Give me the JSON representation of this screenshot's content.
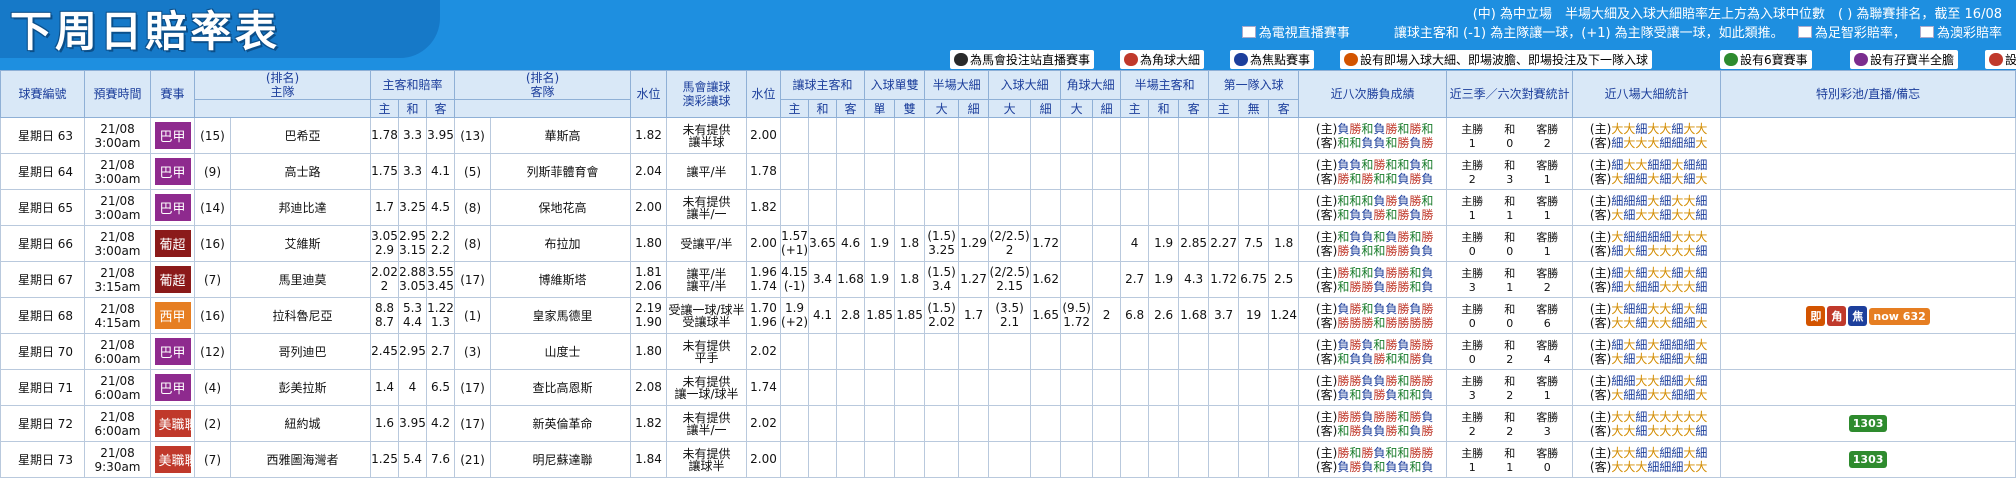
{
  "header": {
    "title": "下周日賠率表",
    "note1": "(中) 為中立場　半場大細及入球大細賠率左上方為入球中位數　( ) 為聯賽排名，截至 16/08",
    "note2_a": "為電視直播賽事",
    "note2_b": "讓球主客和 (-1) 為主隊讓一球，(+1) 為主隊受讓一球，如此類推。",
    "note2_c": "為足智彩賠率，",
    "note2_d": "為澳彩賠率"
  },
  "legend": [
    {
      "label": "為馬會投注站直播賽事",
      "icon": "tv-station-icon",
      "color": "#2a2a2a"
    },
    {
      "label": "為角球大細",
      "icon": "corner-icon",
      "color": "#c0392b"
    },
    {
      "label": "為焦點賽事",
      "icon": "focus-icon",
      "color": "#1d3f9c"
    },
    {
      "label": "設有即場入球大細、即場波膽、即場投注及下一隊入球",
      "icon": "live-icon",
      "color": "#d35400"
    },
    {
      "label": "設有6寶賽事",
      "icon": "six-icon",
      "color": "#2e8b2e"
    },
    {
      "label": "設有孖寶半全膽",
      "icon": "double-icon",
      "color": "#7b2d8e"
    },
    {
      "label": "設有首名入球賽事",
      "icon": "first-scorer-icon",
      "color": "#c0392b"
    }
  ],
  "columns": {
    "match_no": "球賽編號",
    "kickoff": "預賽時間",
    "league": "賽事",
    "home_rank": "(排名)",
    "home": "主隊",
    "hda": "主客和賠率",
    "h": "主",
    "d": "和",
    "a": "客",
    "away_rank": "(排名)",
    "away": "客隊",
    "line": "水位",
    "handicap": "馬會讓球",
    "handicap2": "澳彩讓球",
    "line2": "水位",
    "hhad": "讓球主客和",
    "ooe": "入球單雙",
    "odd": "單",
    "even": "雙",
    "fhl": "半場大細",
    "hil": "入球大細",
    "chl": "角球大細",
    "hi": "大",
    "lo": "細",
    "fha": "半場主客和",
    "fts": "第一隊入球",
    "none": "無",
    "last8": "近八次勝負成績",
    "h2h": "近三季／六次對賽統計",
    "last8hl": "近八場大細統計",
    "notes": "特別彩池/直播/備忘"
  },
  "rows": [
    {
      "no": "星期日 63",
      "date": "21/08",
      "time": "3:00am",
      "league": "巴甲",
      "lcolor": "#8e2a8e",
      "hr": "(15)",
      "home": "巴希亞",
      "h": "1.78",
      "d": "3.3",
      "a": "3.95",
      "ar": "(13)",
      "away": "華斯高",
      "w1": "1.82",
      "hc1": "未有提供",
      "hc2": "讓半球",
      "w2": "2.00",
      "hh": [
        "",
        "",
        ""
      ],
      "oe": [
        "",
        ""
      ],
      "fh": [
        "",
        ""
      ],
      "hl": [
        "",
        ""
      ],
      "ch": [
        "",
        ""
      ],
      "fa": [
        "",
        "",
        ""
      ],
      "ft": [
        "",
        "",
        ""
      ],
      "rec_h": "(主)負勝和負勝和勝和",
      "rec_a": "(客)和和負負和勝負勝",
      "h2h": [
        "主勝",
        "和",
        "客勝",
        "1",
        "0",
        "2"
      ],
      "hl_h": "(主)大大細大大細大大",
      "hl_a": "(客)細大大大細細細大",
      "notes": []
    },
    {
      "no": "星期日 64",
      "date": "21/08",
      "time": "3:00am",
      "league": "巴甲",
      "lcolor": "#8e2a8e",
      "hr": "(9)",
      "home": "高士路",
      "h": "1.75",
      "d": "3.3",
      "a": "4.1",
      "ar": "(5)",
      "away": "列斯菲體育會",
      "w1": "2.04",
      "hc1": "讓平/半",
      "hc2": "",
      "w2": "1.78",
      "hh": [
        "",
        "",
        ""
      ],
      "oe": [
        "",
        ""
      ],
      "fh": [
        "",
        ""
      ],
      "hl": [
        "",
        ""
      ],
      "ch": [
        "",
        ""
      ],
      "fa": [
        "",
        "",
        ""
      ],
      "ft": [
        "",
        "",
        ""
      ],
      "rec_h": "(主)負負和勝和和負和",
      "rec_a": "(客)勝和勝和和負勝負",
      "h2h": [
        "主勝",
        "和",
        "客勝",
        "2",
        "3",
        "1"
      ],
      "hl_h": "(主)細大大細細大細細",
      "hl_a": "(客)大細細大細大細大",
      "notes": []
    },
    {
      "no": "星期日 65",
      "date": "21/08",
      "time": "3:00am",
      "league": "巴甲",
      "lcolor": "#8e2a8e",
      "hr": "(14)",
      "home": "邦迪比達",
      "h": "1.7",
      "d": "3.25",
      "a": "4.5",
      "ar": "(8)",
      "away": "保地花高",
      "w1": "2.00",
      "hc1": "未有提供",
      "hc2": "讓半/一",
      "w2": "1.82",
      "hh": [
        "",
        "",
        ""
      ],
      "oe": [
        "",
        ""
      ],
      "fh": [
        "",
        ""
      ],
      "hl": [
        "",
        ""
      ],
      "ch": [
        "",
        ""
      ],
      "fa": [
        "",
        "",
        ""
      ],
      "ft": [
        "",
        "",
        ""
      ],
      "rec_h": "(主)和和和負勝負勝和",
      "rec_a": "(客)和負負勝和勝負勝",
      "h2h": [
        "主勝",
        "和",
        "客勝",
        "1",
        "1",
        "1"
      ],
      "hl_h": "(主)細細細大細大大細",
      "hl_a": "(客)大細大大細大大細",
      "notes": []
    },
    {
      "no": "星期日 66",
      "date": "21/08",
      "time": "3:00am",
      "league": "葡超",
      "lcolor": "#8b1a1a",
      "hr": "(16)",
      "home": "艾維斯",
      "h": "3.05",
      "d": "2.95",
      "a": "2.2",
      "h2": "2.9",
      "d2": "3.15",
      "a2": "2.2",
      "ar": "(8)",
      "away": "布拉加",
      "w1": "1.80",
      "hc1": "受讓平/半",
      "hc2": "",
      "w2": "2.00",
      "hh": [
        "1.57",
        "3.65",
        "4.6"
      ],
      "hhl": "(+1)",
      "oe": [
        "1.9",
        "1.8"
      ],
      "fh": [
        "(1.5)",
        ""
      ],
      "fhv": [
        "3.25",
        "1.29"
      ],
      "hl": [
        "(2/2.5)",
        ""
      ],
      "hlv": [
        "2",
        "1.72"
      ],
      "ch": [
        "",
        ""
      ],
      "fa": [
        "4",
        "1.9",
        "2.85"
      ],
      "ft": [
        "2.27",
        "7.5",
        "1.8"
      ],
      "rec_h": "(主)和負負和負勝和勝",
      "rec_a": "(客)勝負和和勝勝負負",
      "h2h": [
        "主勝",
        "和",
        "客勝",
        "0",
        "0",
        "1"
      ],
      "hl_h": "(主)大細細細細大大大",
      "hl_a": "(客)細大細大大大大細",
      "notes": []
    },
    {
      "no": "星期日 67",
      "date": "21/08",
      "time": "3:15am",
      "league": "葡超",
      "lcolor": "#8b1a1a",
      "hr": "(7)",
      "home": "馬里迪莫",
      "h": "2.02",
      "d": "2.88",
      "a": "3.55",
      "h2": "2",
      "d2": "3.05",
      "a2": "3.45",
      "ar": "(17)",
      "away": "博維斯塔",
      "w1": "1.81",
      "w1b": "2.06",
      "hc1": "讓平/半",
      "hc2": "讓平/半",
      "w2": "1.96",
      "w2b": "1.74",
      "hh": [
        "4.15",
        "3.4",
        "1.68"
      ],
      "hhl": "(-1)",
      "oe": [
        "1.9",
        "1.8"
      ],
      "fh": [
        "(1.5)",
        ""
      ],
      "fhv": [
        "3.4",
        "1.27"
      ],
      "hl": [
        "(2/2.5)",
        ""
      ],
      "hlv": [
        "2.15",
        "1.62"
      ],
      "ch": [
        "",
        ""
      ],
      "fa": [
        "2.7",
        "1.9",
        "4.3"
      ],
      "ft": [
        "1.72",
        "6.75",
        "2.5"
      ],
      "rec_h": "(主)勝和和負勝勝和負",
      "rec_a": "(客)和勝勝負勝勝和負",
      "h2h": [
        "主勝",
        "和",
        "客勝",
        "3",
        "1",
        "2"
      ],
      "hl_h": "(主)細大細大大細大細",
      "hl_a": "(客)細大細細大大大細",
      "notes": []
    },
    {
      "no": "星期日 68",
      "date": "21/08",
      "time": "4:15am",
      "league": "西甲",
      "lcolor": "#e67e22",
      "hr": "(16)",
      "home": "拉科魯尼亞",
      "h": "8.8",
      "d": "5.3",
      "a": "1.22",
      "h2": "8.7",
      "d2": "4.4",
      "a2": "1.3",
      "ar": "(1)",
      "away": "皇家馬德里",
      "w1": "2.19",
      "w1b": "1.90",
      "hc1": "受讓一球/球半",
      "hc2": "受讓球半",
      "w2": "1.70",
      "w2b": "1.96",
      "hh": [
        "1.9",
        "4.1",
        "2.8"
      ],
      "hhl": "(+2)",
      "oe": [
        "1.85",
        "1.85"
      ],
      "fh": [
        "(1.5)",
        ""
      ],
      "fhv": [
        "2.02",
        "1.7"
      ],
      "hl": [
        "(3.5)",
        ""
      ],
      "hlv": [
        "2.1",
        "1.65"
      ],
      "ch": [
        "(9.5)",
        ""
      ],
      "chv": [
        "1.72",
        "2"
      ],
      "fa": [
        "6.8",
        "2.6",
        "1.68"
      ],
      "ft": [
        "3.7",
        "19",
        "1.24"
      ],
      "rec_h": "(主)負勝和負負勝負勝",
      "rec_a": "(客)勝勝勝和勝勝勝勝",
      "h2h": [
        "主勝",
        "和",
        "客勝",
        "0",
        "0",
        "6"
      ],
      "hl_h": "(主)大細細大大細大細",
      "hl_a": "(客)大大細大大細細大",
      "notes": [
        "live",
        "corner",
        "focus",
        "now632"
      ]
    },
    {
      "no": "星期日 70",
      "date": "21/08",
      "time": "6:00am",
      "league": "巴甲",
      "lcolor": "#8e2a8e",
      "hr": "(12)",
      "home": "哥列迪巴",
      "h": "2.45",
      "d": "2.95",
      "a": "2.7",
      "ar": "(3)",
      "away": "山度士",
      "w1": "1.80",
      "hc1": "未有提供",
      "hc2": "平手",
      "w2": "2.02",
      "hh": [
        "",
        "",
        ""
      ],
      "oe": [
        "",
        ""
      ],
      "fh": [
        "",
        ""
      ],
      "hl": [
        "",
        ""
      ],
      "ch": [
        "",
        ""
      ],
      "fa": [
        "",
        "",
        ""
      ],
      "ft": [
        "",
        "",
        ""
      ],
      "rec_h": "(主)負勝負和勝負勝勝",
      "rec_a": "(客)和負負勝和和勝負",
      "h2h": [
        "主勝",
        "和",
        "客勝",
        "0",
        "2",
        "4"
      ],
      "hl_h": "(主)細大細大細細細大",
      "hl_a": "(客)大細大大細細大細",
      "notes": []
    },
    {
      "no": "星期日 71",
      "date": "21/08",
      "time": "6:00am",
      "league": "巴甲",
      "lcolor": "#8e2a8e",
      "hr": "(4)",
      "home": "彭美拉斯",
      "h": "1.4",
      "d": "4",
      "a": "6.5",
      "ar": "(17)",
      "away": "查比高恩斯",
      "w1": "2.08",
      "hc1": "未有提供",
      "hc2": "讓一球/球半",
      "w2": "1.74",
      "hh": [
        "",
        "",
        ""
      ],
      "oe": [
        "",
        ""
      ],
      "fh": [
        "",
        ""
      ],
      "hl": [
        "",
        ""
      ],
      "ch": [
        "",
        ""
      ],
      "fa": [
        "",
        "",
        ""
      ],
      "ft": [
        "",
        "",
        ""
      ],
      "rec_h": "(主)勝勝負負勝和勝勝",
      "rec_a": "(客)負和負勝負和和負",
      "h2h": [
        "主勝",
        "和",
        "客勝",
        "3",
        "2",
        "1"
      ],
      "hl_h": "(主)細細大大細細大細",
      "hl_a": "(客)大細細大大細細大",
      "notes": []
    },
    {
      "no": "星期日 72",
      "date": "21/08",
      "time": "6:00am",
      "league": "美職聯",
      "lcolor": "#c0392b",
      "hr": "(2)",
      "home": "紐約城",
      "h": "1.6",
      "d": "3.95",
      "a": "4.2",
      "ar": "(17)",
      "away": "新英倫革命",
      "w1": "1.82",
      "hc1": "未有提供",
      "hc2": "讓半/一",
      "w2": "2.02",
      "hh": [
        "",
        "",
        ""
      ],
      "oe": [
        "",
        ""
      ],
      "fh": [
        "",
        ""
      ],
      "hl": [
        "",
        ""
      ],
      "ch": [
        "",
        ""
      ],
      "fa": [
        "",
        "",
        ""
      ],
      "ft": [
        "",
        "",
        ""
      ],
      "rec_h": "(主)勝勝負勝勝和勝負",
      "rec_a": "(客)和勝負負勝和負勝",
      "h2h": [
        "主勝",
        "和",
        "客勝",
        "2",
        "2",
        "3"
      ],
      "hl_h": "(主)大大細大大大大大",
      "hl_a": "(客)大大細大大大大細",
      "notes": [
        "tv1303"
      ]
    },
    {
      "no": "星期日 73",
      "date": "21/08",
      "time": "9:30am",
      "league": "美職聯",
      "lcolor": "#c0392b",
      "hr": "(7)",
      "home": "西雅圖海灣者",
      "h": "1.25",
      "d": "5.4",
      "a": "7.6",
      "ar": "(21)",
      "away": "明尼蘇達聯",
      "w1": "1.84",
      "hc1": "未有提供",
      "hc2": "讓球半",
      "w2": "2.00",
      "hh": [
        "",
        "",
        ""
      ],
      "oe": [
        "",
        ""
      ],
      "fh": [
        "",
        ""
      ],
      "hl": [
        "",
        ""
      ],
      "ch": [
        "",
        ""
      ],
      "fa": [
        "",
        "",
        ""
      ],
      "ft": [
        "",
        "",
        ""
      ],
      "rec_h": "(主)勝和勝負和和勝勝",
      "rec_a": "(客)負勝負和負負和負",
      "h2h": [
        "主勝",
        "和",
        "客勝",
        "1",
        "1",
        "0"
      ],
      "hl_h": "(主)大大細大細細大細",
      "hl_a": "(客)大大大細細細大大",
      "notes": [
        "tv1303"
      ]
    }
  ],
  "badges": {
    "live": {
      "label": "即",
      "color": "#d35400"
    },
    "corner": {
      "label": "角",
      "color": "#c0392b"
    },
    "focus": {
      "label": "焦",
      "color": "#1d3f9c"
    },
    "now632": {
      "label": "now 632",
      "color": "#e67e22"
    },
    "tv1303": {
      "label": "1303",
      "color": "#2e8b2e"
    }
  }
}
